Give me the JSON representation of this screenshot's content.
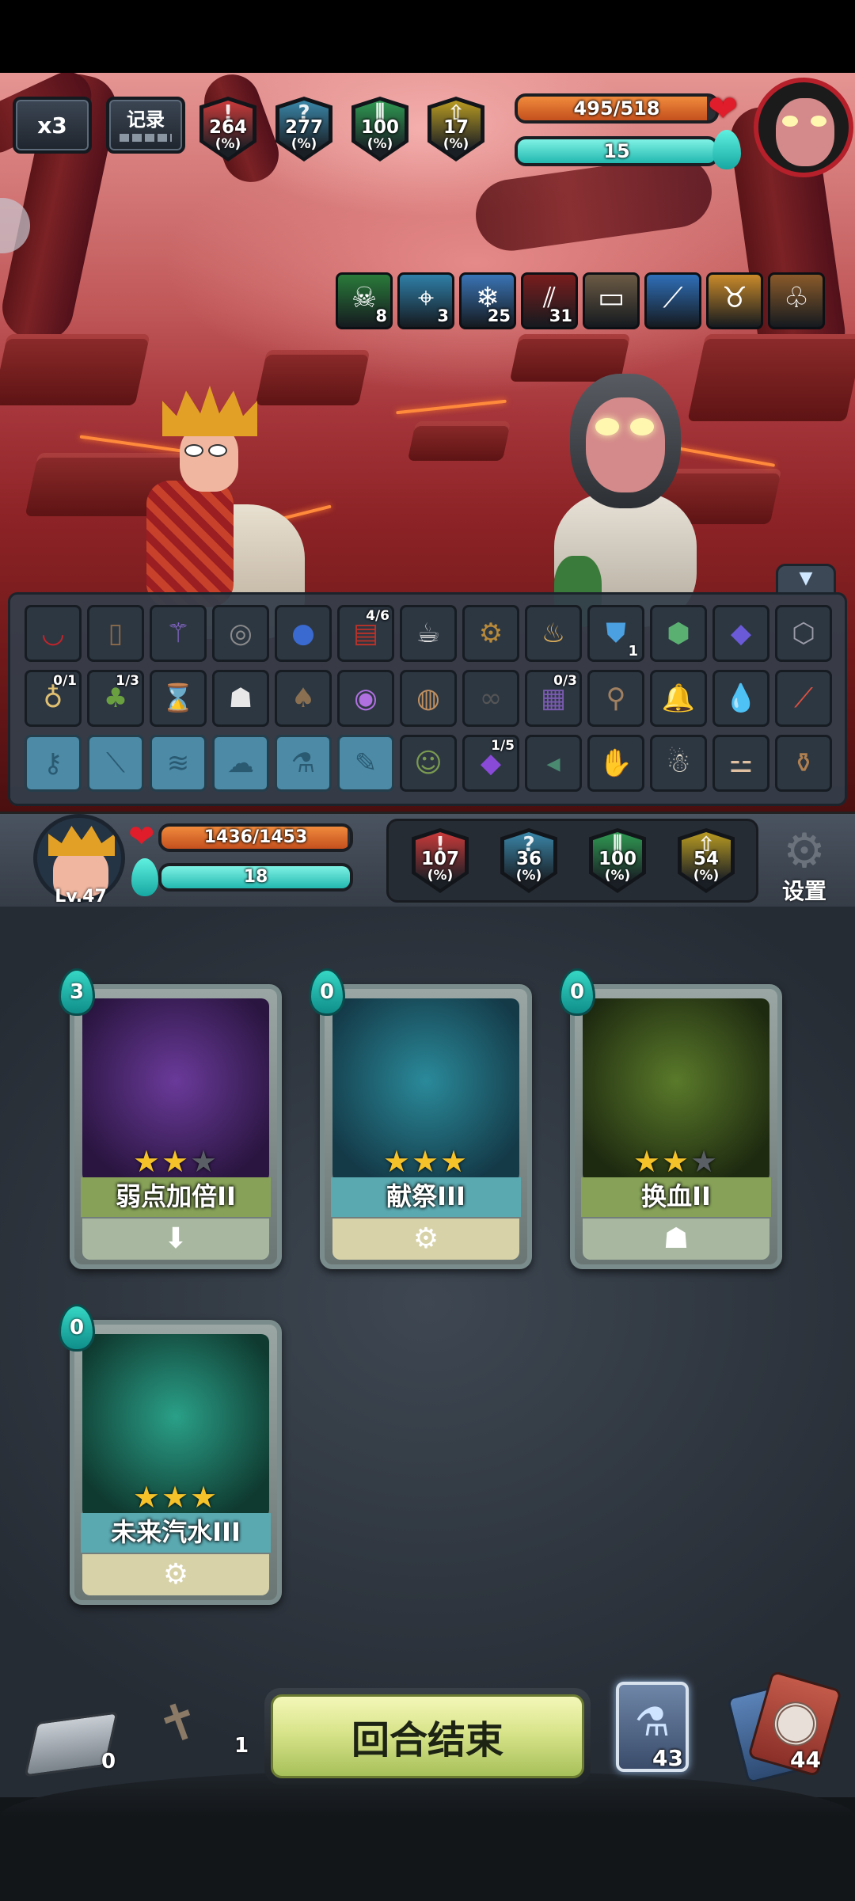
{
  "top_controls": {
    "speed": "x3",
    "record": "记录"
  },
  "enemy_stats": [
    {
      "value": "264",
      "unit": "(%)",
      "icon": "attack-icon",
      "color": "#c93a3a"
    },
    {
      "value": "277",
      "unit": "(%)",
      "icon": "question-icon",
      "color": "#3a86a8"
    },
    {
      "value": "100",
      "unit": "(%)",
      "icon": "defense-icon",
      "color": "#2f9a52"
    },
    {
      "value": "17",
      "unit": "(%)",
      "icon": "crit-icon",
      "color": "#b89a22"
    }
  ],
  "enemy": {
    "hp_text": "495/518",
    "hp_ratio": 0.956,
    "energy_text": "15",
    "energy_ratio": 1.0
  },
  "enemy_effects": [
    {
      "icon": "skull-icon",
      "count": "8",
      "glyph": "☠",
      "color": "#2a7a3a"
    },
    {
      "icon": "target-icon",
      "count": "3",
      "glyph": "⌖",
      "color": "#2f7fa8"
    },
    {
      "icon": "snowflake-icon",
      "count": "25",
      "glyph": "❄",
      "color": "#3a74b5"
    },
    {
      "icon": "claw-icon",
      "count": "31",
      "glyph": "⫽",
      "color": "#7a1d1d"
    },
    {
      "icon": "book-icon",
      "count": "",
      "glyph": "▭",
      "color": "#6b5a44"
    },
    {
      "icon": "feather-icon",
      "count": "",
      "glyph": "⟋",
      "color": "#2f6fb8"
    },
    {
      "icon": "beast-icon",
      "count": "",
      "glyph": "♉",
      "color": "#c98a2a"
    },
    {
      "icon": "plant-icon",
      "count": "",
      "glyph": "♧",
      "color": "#8a5a2a"
    }
  ],
  "relics": [
    [
      {
        "icon": "lips-icon",
        "glyph": "◡",
        "c": "#c0242a",
        "n": ""
      },
      {
        "icon": "scroll-icon",
        "glyph": "▯",
        "c": "#8a6a4a",
        "n": ""
      },
      {
        "icon": "staff-icon",
        "glyph": "⚚",
        "c": "#8a6ad0",
        "n": ""
      },
      {
        "icon": "bracelet-icon",
        "glyph": "◎",
        "c": "#8a8a8a",
        "n": ""
      },
      {
        "icon": "egg-icon",
        "glyph": "●",
        "c": "#3a6ad0",
        "n": ""
      },
      {
        "icon": "spellbook-icon",
        "glyph": "▤",
        "c": "#b8322a",
        "n": "4/6"
      },
      {
        "icon": "teacup-icon",
        "glyph": "☕",
        "c": "#ddd",
        "n": ""
      },
      {
        "icon": "gear-orb-icon",
        "glyph": "⚙",
        "c": "#b88a3a",
        "n": ""
      },
      {
        "icon": "pouch-icon",
        "glyph": "♨",
        "c": "#e0b05a",
        "n": ""
      },
      {
        "icon": "blue-shield-icon",
        "glyph": "⛊",
        "c": "#4aa0e0",
        "n": "1",
        "bottom": true
      },
      {
        "icon": "turtle-shell-icon",
        "glyph": "⬢",
        "c": "#5ab070",
        "n": ""
      },
      {
        "icon": "gem-icon",
        "glyph": "◆",
        "c": "#6a5ad8",
        "n": ""
      },
      {
        "icon": "token-icon",
        "glyph": "⬡",
        "c": "#9a9aa8",
        "n": ""
      }
    ],
    [
      {
        "icon": "pacifier-icon",
        "glyph": "♁",
        "c": "#e0c070",
        "n": "0/1"
      },
      {
        "icon": "sprout-icon",
        "glyph": "♣",
        "c": "#6aa040",
        "n": "1/3"
      },
      {
        "icon": "hourglass-icon",
        "glyph": "⌛",
        "c": "#d0a050",
        "n": ""
      },
      {
        "icon": "ghost-icon",
        "glyph": "☗",
        "c": "#e8e8e8",
        "n": ""
      },
      {
        "icon": "sack-icon",
        "glyph": "♠",
        "c": "#8a7050",
        "n": ""
      },
      {
        "icon": "crystal-ball-icon",
        "glyph": "◉",
        "c": "#b070e0",
        "n": ""
      },
      {
        "icon": "drum-icon",
        "glyph": "◍",
        "c": "#c09060",
        "n": ""
      },
      {
        "icon": "goggles-icon",
        "glyph": "∞",
        "c": "#555",
        "n": ""
      },
      {
        "icon": "tome-icon",
        "glyph": "▦",
        "c": "#7a5ab0",
        "n": "0/3"
      },
      {
        "icon": "broom-icon",
        "glyph": "⚲",
        "c": "#a08060",
        "n": ""
      },
      {
        "icon": "bell-icon",
        "glyph": "🔔",
        "c": "#c08040",
        "n": ""
      },
      {
        "icon": "water-drop-icon",
        "glyph": "💧",
        "c": "#3aa0e0",
        "n": ""
      },
      {
        "icon": "sword-icon",
        "glyph": "⟋",
        "c": "#e05040",
        "n": ""
      }
    ],
    [
      {
        "icon": "locked-slot-1-icon",
        "glyph": "⚷",
        "c": "#2a5a72",
        "n": "",
        "locked": true
      },
      {
        "icon": "locked-slot-2-icon",
        "glyph": "⟍",
        "c": "#2a5a72",
        "n": "",
        "locked": true
      },
      {
        "icon": "locked-slot-3-icon",
        "glyph": "≋",
        "c": "#2a5a72",
        "n": "",
        "locked": true
      },
      {
        "icon": "locked-slot-4-icon",
        "glyph": "☁",
        "c": "#2a5a72",
        "n": "",
        "locked": true
      },
      {
        "icon": "locked-slot-5-icon",
        "glyph": "⚗",
        "c": "#2a5a72",
        "n": "",
        "locked": true
      },
      {
        "icon": "locked-slot-6-icon",
        "glyph": "✎",
        "c": "#2a5a72",
        "n": "",
        "locked": true
      },
      {
        "icon": "goblin-icon",
        "glyph": "☺",
        "c": "#7a9a50",
        "n": ""
      },
      {
        "icon": "amethyst-icon",
        "glyph": "◆",
        "c": "#8a4ad8",
        "n": "1/5"
      },
      {
        "icon": "fish-icon",
        "glyph": "◂",
        "c": "#4a8a70",
        "n": ""
      },
      {
        "icon": "claw-hand-icon",
        "glyph": "✋",
        "c": "#9a6a40",
        "n": ""
      },
      {
        "icon": "doll-icon",
        "glyph": "☃",
        "c": "#e8e0d0",
        "n": ""
      },
      {
        "icon": "bone-icon",
        "glyph": "⚍",
        "c": "#e0c0a0",
        "n": ""
      },
      {
        "icon": "bottle-icon",
        "glyph": "⚱",
        "c": "#b08050",
        "n": ""
      }
    ]
  ],
  "player": {
    "level": "Lv.47",
    "hp_text": "1436/1453",
    "hp_ratio": 0.988,
    "energy_text": "18",
    "energy_ratio": 1.0
  },
  "player_stats": [
    {
      "value": "107",
      "unit": "(%)",
      "icon": "attack-icon",
      "color": "#c93a3a"
    },
    {
      "value": "36",
      "unit": "(%)",
      "icon": "question-icon",
      "color": "#3a86a8"
    },
    {
      "value": "100",
      "unit": "(%)",
      "icon": "defense-icon",
      "color": "#2f9a52"
    },
    {
      "value": "54",
      "unit": "(%)",
      "icon": "crit-icon",
      "color": "#b89a22"
    }
  ],
  "settings_label": "设置",
  "cards": [
    {
      "cost": "3",
      "name": "弱点加倍II",
      "stars": 2,
      "foot_glyph": "⬇",
      "art": "robot-target-icon",
      "art_c1": "#6a3a9a",
      "art_c2": "#2a1540",
      "band": "#87a258",
      "foot": "#a8b8a0"
    },
    {
      "cost": "0",
      "name": "献祭III",
      "stars": 3,
      "foot_glyph": "⚙",
      "art": "cyan-wind-icon",
      "art_c1": "#2a8a9a",
      "art_c2": "#143a48",
      "band": "#5aa8b0",
      "foot": "#d8d2a8"
    },
    {
      "cost": "0",
      "name": "换血II",
      "stars": 2,
      "foot_glyph": "☗",
      "art": "green-hourglass-icon",
      "art_c1": "#5a7a2a",
      "art_c2": "#1e2a10",
      "band": "#87a258",
      "foot": "#a8b8a0"
    },
    {
      "cost": "0",
      "name": "未来汽水III",
      "stars": 3,
      "foot_glyph": "⚙",
      "art": "soda-bottle-icon",
      "art_c1": "#2aa088",
      "art_c2": "#0f3a30",
      "band": "#5aa8b0",
      "foot": "#d8d2a8"
    }
  ],
  "bottom": {
    "discard_count": "0",
    "exhaust_count": "1",
    "end_turn_label": "回合结束",
    "potion_count": "43",
    "draw_count": "44"
  }
}
